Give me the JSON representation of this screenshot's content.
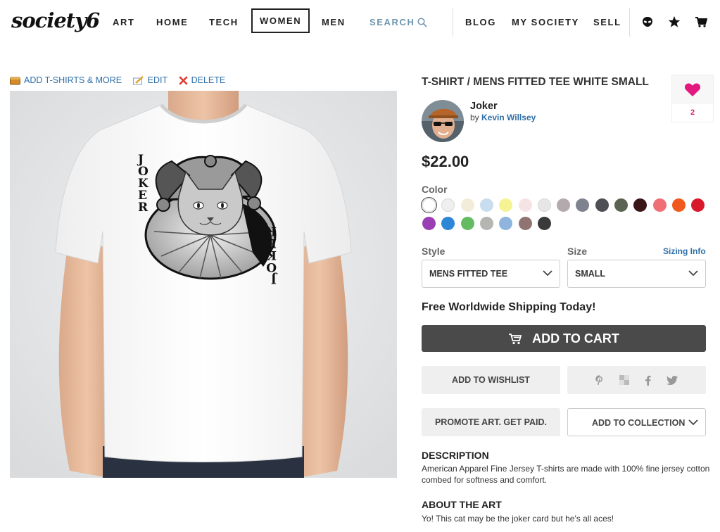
{
  "header": {
    "logo": "society6",
    "nav": [
      "ART",
      "HOME",
      "TECH",
      "WOMEN",
      "MEN"
    ],
    "search_label": "SEARCH",
    "nav_right": [
      "BLOG",
      "MY SOCIETY",
      "SELL"
    ],
    "icons": [
      "alien-icon",
      "star-icon",
      "cart-icon"
    ]
  },
  "toolbar": {
    "add_label": "ADD T-SHIRTS & MORE",
    "edit_label": "EDIT",
    "delete_label": "DELETE"
  },
  "product": {
    "title": "T-SHIRT / MENS FITTED TEE WHITE SMALL",
    "art_name": "Joker",
    "by_label": "by",
    "artist": "Kevin Willsey",
    "price": "$22.00",
    "likes": "2",
    "card_text": "JOKER"
  },
  "color": {
    "label": "Color",
    "swatches": [
      "#ffffff",
      "#efefef",
      "#f3ecd8",
      "#c8ddef",
      "#f6f394",
      "#f6e3e5",
      "#e6e6e6",
      "#b4a9ad",
      "#7f8390",
      "#4d4f55",
      "#5a6450",
      "#3b1616",
      "#ef6f74",
      "#f0581e",
      "#d8192b",
      "#9a3fb3",
      "#2e86d6",
      "#65bb62",
      "#b5b5b2",
      "#8fb4dd",
      "#8f7471",
      "#3a3a3a"
    ],
    "selected_index": 0
  },
  "options": {
    "style_label": "Style",
    "style_value": "MENS FITTED TEE",
    "size_label": "Size",
    "size_value": "SMALL",
    "sizing_info": "Sizing Info"
  },
  "shipping": "Free Worldwide Shipping Today!",
  "buttons": {
    "add_to_cart": "ADD TO CART",
    "add_to_wishlist": "ADD TO WISHLIST",
    "promote": "PROMOTE ART. GET PAID.",
    "add_to_collection": "ADD TO COLLECTION"
  },
  "share": [
    "pinterest-icon",
    "tumblr-icon",
    "facebook-icon",
    "twitter-icon"
  ],
  "description": {
    "heading": "DESCRIPTION",
    "text": "American Apparel Fine Jersey T-shirts are made with 100% fine jersey cotton combed for softness and comfort."
  },
  "about": {
    "heading": "ABOUT THE ART",
    "text": "Yo! This cat may be the joker card but he's all aces!"
  },
  "colors": {
    "link": "#2f6fa7",
    "search": "#6e96ad",
    "heart": "#e3197f",
    "cart_button": "#4a4a4a"
  }
}
